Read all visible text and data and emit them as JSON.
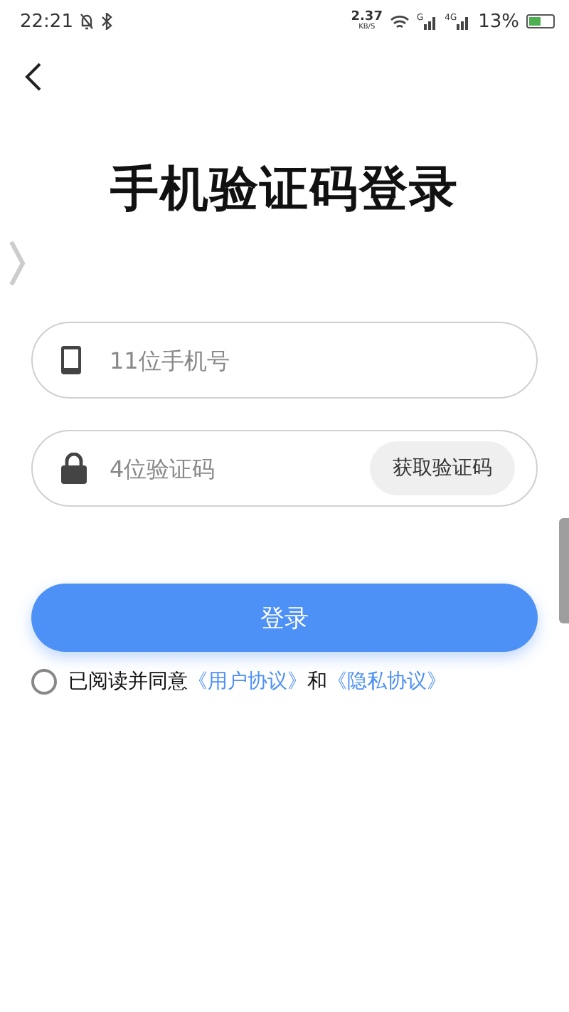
{
  "status_bar": {
    "time": "22:21",
    "speed": "2.37",
    "speed_unit": "KB/S",
    "sim1": "G",
    "sim2": "4G",
    "battery": "13%"
  },
  "title": "手机验证码登录",
  "phone_field": {
    "placeholder": "11位手机号"
  },
  "code_field": {
    "placeholder": "4位验证码",
    "button": "获取验证码"
  },
  "login_button": "登录",
  "agreement": {
    "checked": false,
    "prefix": "已阅读并同意",
    "link1": "《用户协议》",
    "middle": "和",
    "link2": "《隐私协议》"
  }
}
